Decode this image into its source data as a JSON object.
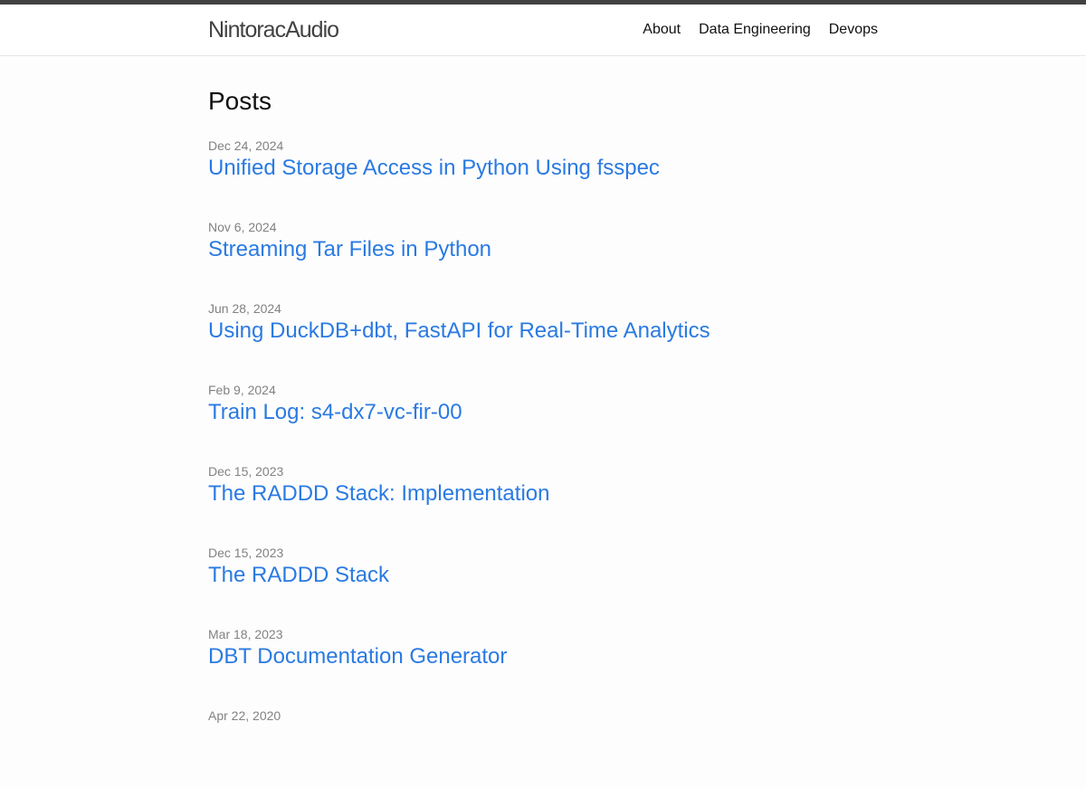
{
  "header": {
    "site_title": "NintoracAudio",
    "nav": [
      {
        "label": "About"
      },
      {
        "label": "Data Engineering"
      },
      {
        "label": "Devops"
      }
    ]
  },
  "main": {
    "heading": "Posts",
    "posts": [
      {
        "date": "Dec 24, 2024",
        "title": "Unified Storage Access in Python Using fsspec"
      },
      {
        "date": "Nov 6, 2024",
        "title": "Streaming Tar Files in Python"
      },
      {
        "date": "Jun 28, 2024",
        "title": "Using DuckDB+dbt, FastAPI for Real-Time Analytics"
      },
      {
        "date": "Feb 9, 2024",
        "title": "Train Log: s4-dx7-vc-fir-00"
      },
      {
        "date": "Dec 15, 2023",
        "title": "The RADDD Stack: Implementation"
      },
      {
        "date": "Dec 15, 2023",
        "title": "The RADDD Stack"
      },
      {
        "date": "Mar 18, 2023",
        "title": "DBT Documentation Generator"
      },
      {
        "date": "Apr 22, 2020",
        "title": ""
      }
    ]
  },
  "colors": {
    "link": "#2a7ae2",
    "meta": "#828282",
    "top_bar": "#424242",
    "background": "#fdfdfd"
  }
}
